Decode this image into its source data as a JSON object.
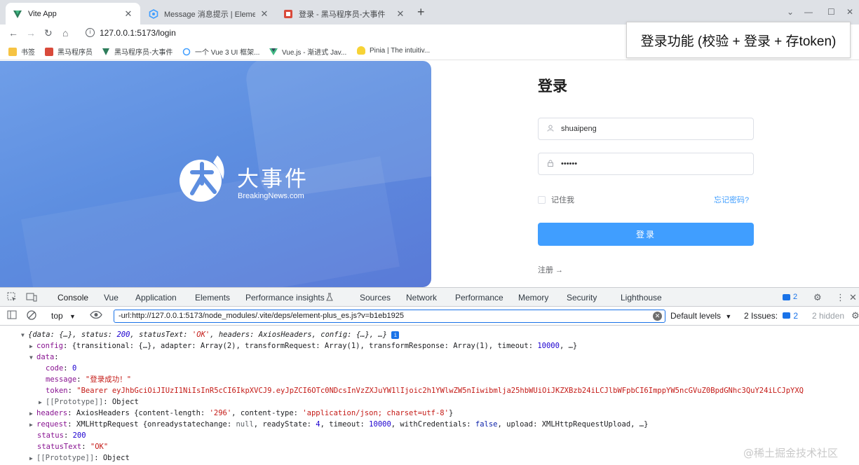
{
  "browser": {
    "tabs": [
      {
        "title": "Vite App",
        "active": true,
        "icon": "vite-icon"
      },
      {
        "title": "Message 消息提示 | Element Pl",
        "active": false,
        "icon": "element-icon"
      },
      {
        "title": "登录 - 黑马程序员-大事件",
        "active": false,
        "icon": "heima-icon"
      }
    ],
    "url": "127.0.0.1:5173/login",
    "bookmarks": [
      "书签",
      "黑马程序员",
      "黑马程序员-大事件",
      "一个 Vue 3 UI 框架...",
      "Vue.js - 渐进式 Jav...",
      "Pinia | The intuitiv..."
    ]
  },
  "caption": "登录功能 (校验 + 登录 + 存token)",
  "hero": {
    "brand_cn": "大事件",
    "brand_en": "BreakingNews.com"
  },
  "login": {
    "title": "登录",
    "username_value": "shuaipeng",
    "password_value": "••••••",
    "remember_label": "记住我",
    "forgot_label": "忘记密码?",
    "submit_label": "登录",
    "register_label": "注册 →"
  },
  "devtools": {
    "tabs": [
      "Console",
      "Vue",
      "Application",
      "Elements",
      "Performance insights",
      "Sources",
      "Network",
      "Performance",
      "Memory",
      "Security",
      "Lighthouse"
    ],
    "issues_count": "2",
    "context": "top",
    "filter": "-url:http://127.0.0.1:5173/node_modules/.vite/deps/element-plus_es.js?v=b1eb1925",
    "levels": "Default levels",
    "issues_label": "2 Issues:",
    "issues_num": "2",
    "hidden": "2 hidden"
  },
  "console": {
    "summary_status": "200",
    "summary_statusText": "'OK'",
    "timeout": "10000",
    "code": "0",
    "message": "\"登录成功！\"",
    "token": "\"Bearer eyJhbGciOiJIUzI1NiIsInR5cCI6IkpXVCJ9.eyJpZCI6OTc0NDcsInVzZXJuYW1lIjoic2h1YWlwZW5nIiwibmlja25hbWUiOiJKZXBzb24iLCJlbWFpbCI6ImppYW5ncGVuZ0BpdGNhc3QuY24iLCJpYXQ",
    "content_length": "'296'",
    "content_type": "'application/json; charset=utf-8'",
    "ready_state": "4",
    "status": "200",
    "statusText": "\"OK\""
  },
  "watermark": "@稀土掘金技术社区",
  "colors": {
    "accent": "#409eff",
    "devtools_blue": "#1a73e8",
    "hero": "#5d8ee0"
  }
}
